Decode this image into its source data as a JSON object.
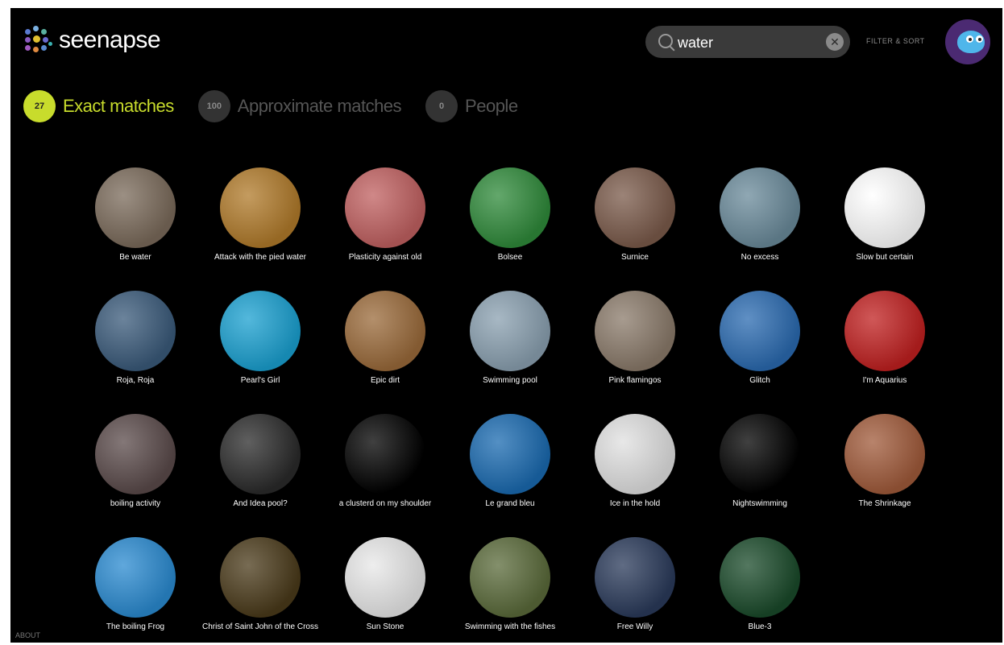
{
  "header": {
    "logo_text": "seenapse",
    "search": {
      "value": "water",
      "clear_icon": "clear-icon"
    },
    "filter_label": "FILTER & SORT"
  },
  "tabs": [
    {
      "count": "27",
      "label": "Exact matches",
      "active": true
    },
    {
      "count": "100",
      "label": "Approximate matches",
      "active": false
    },
    {
      "count": "0",
      "label": "People",
      "active": false
    }
  ],
  "results": [
    {
      "title": "Be water",
      "color": "#7a6a5a"
    },
    {
      "title": "Attack with the pied water",
      "color": "#b07a2a"
    },
    {
      "title": "Plasticity against old",
      "color": "#c06060"
    },
    {
      "title": "Bolsee",
      "color": "#2f8a3a"
    },
    {
      "title": "Surnice",
      "color": "#7a5a4a"
    },
    {
      "title": "No excess",
      "color": "#6a8a9a"
    },
    {
      "title": "Slow but certain",
      "color": "#ffffff"
    },
    {
      "title": "Roja, Roja",
      "color": "#3a5a7a"
    },
    {
      "title": "Pearl's Girl",
      "color": "#1aa0d0"
    },
    {
      "title": "Epic dirt",
      "color": "#9a6a3a"
    },
    {
      "title": "Swimming pool",
      "color": "#8aa0b0"
    },
    {
      "title": "Pink flamingos",
      "color": "#8a7a6a"
    },
    {
      "title": "Glitch",
      "color": "#2a6ab0"
    },
    {
      "title": "I'm Aquarius",
      "color": "#c02020"
    },
    {
      "title": "boiling activity",
      "color": "#5a4a4a"
    },
    {
      "title": "And Idea pool?",
      "color": "#2a2a2a"
    },
    {
      "title": "a clusterd on my shoulder",
      "color": "#000000"
    },
    {
      "title": "Le grand bleu",
      "color": "#1a6ab0"
    },
    {
      "title": "Ice in the hold",
      "color": "#e0e0e0"
    },
    {
      "title": "Nightswimming",
      "color": "#000000"
    },
    {
      "title": "The Shrinkage",
      "color": "#a05a3a"
    },
    {
      "title": "The boiling Frog",
      "color": "#2a8ad0"
    },
    {
      "title": "Christ of Saint John of the Cross",
      "color": "#4a3a1a"
    },
    {
      "title": "Sun Stone",
      "color": "#e8e8e8"
    },
    {
      "title": "Swimming with the fishes",
      "color": "#5a6a3a"
    },
    {
      "title": "Free Willy",
      "color": "#2a3a5a"
    },
    {
      "title": "Blue-3",
      "color": "#1a4a2a"
    }
  ],
  "footer": {
    "about": "ABOUT"
  },
  "colors": {
    "accent": "#c8dc2c",
    "background": "#000000"
  }
}
